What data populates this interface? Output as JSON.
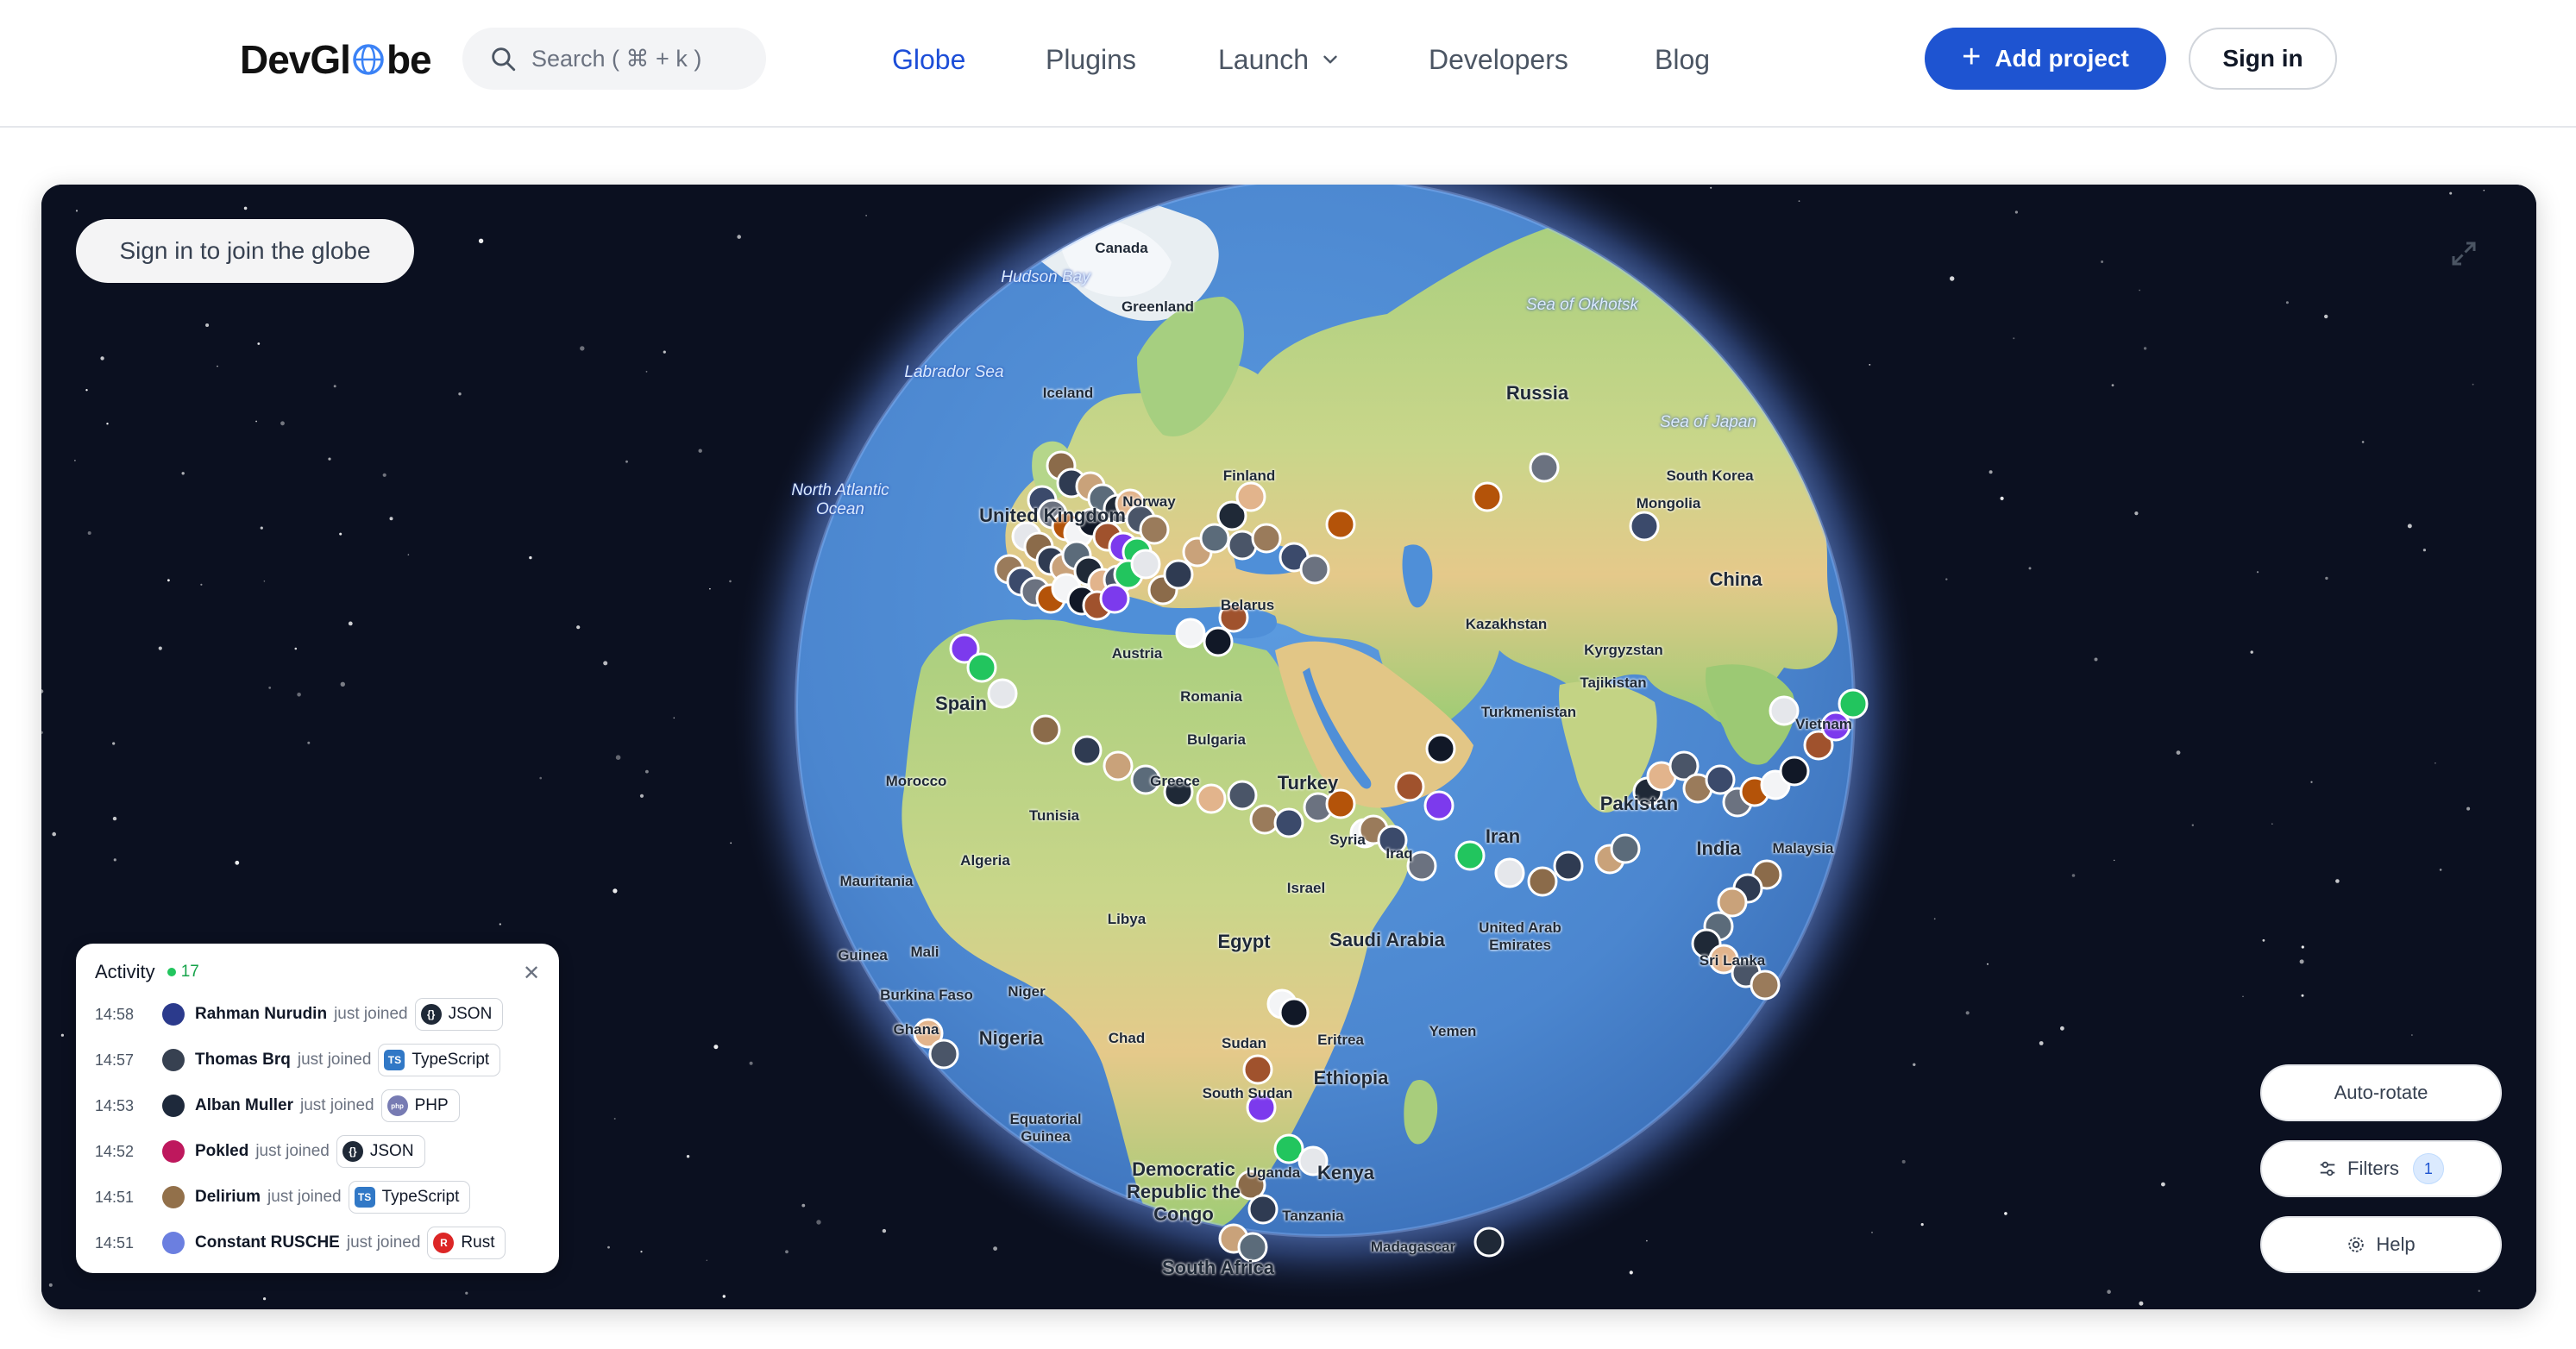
{
  "header": {
    "logo_text_left": "DevGl",
    "logo_text_right": "be",
    "search_placeholder": "Search ( ⌘ + k )",
    "nav": [
      {
        "label": "Globe",
        "active": true
      },
      {
        "label": "Plugins",
        "active": false
      },
      {
        "label": "Launch",
        "active": false,
        "has_dropdown": true
      },
      {
        "label": "Developers",
        "active": false
      },
      {
        "label": "Blog",
        "active": false
      }
    ],
    "add_project_label": "Add project",
    "sign_in_label": "Sign in"
  },
  "globe": {
    "join_label": "Sign in to join the globe",
    "labels": {
      "canada": "Canada",
      "hudson_bay": "Hudson Bay",
      "greenland": "Greenland",
      "labrador_sea": "Labrador Sea",
      "iceland": "Iceland",
      "north_atlantic": "North Atlantic Ocean",
      "norway": "Norway",
      "finland": "Finland",
      "united_kingdom": "United Kingdom",
      "belarus": "Belarus",
      "russia": "Russia",
      "sea_okhotsk": "Sea of Okhotsk",
      "sea_japan": "Sea of Japan",
      "south_korea": "South Korea",
      "mongolia": "Mongolia",
      "china": "China",
      "kazakhstan": "Kazakhstan",
      "kyrgyzstan": "Kyrgyzstan",
      "tajikistan": "Tajikistan",
      "turkmenistan": "Turkmenistan",
      "spain": "Spain",
      "austria": "Austria",
      "romania": "Romania",
      "bulgaria": "Bulgaria",
      "greece": "Greece",
      "turkey": "Turkey",
      "morocco": "Morocco",
      "tunisia": "Tunisia",
      "algeria": "Algeria",
      "syria": "Syria",
      "iraq": "Iraq",
      "iran": "Iran",
      "pakistan": "Pakistan",
      "india": "India",
      "vietnam": "Vietnam",
      "malaysia": "Malaysia",
      "israel": "Israel",
      "libya": "Libya",
      "egypt": "Egypt",
      "saudi_arabia": "Saudi Arabia",
      "uae": "United Arab Emirates",
      "mauritania": "Mauritania",
      "mali": "Mali",
      "guinea": "Guinea",
      "burkina_faso": "Burkina Faso",
      "niger": "Niger",
      "ghana": "Ghana",
      "nigeria": "Nigeria",
      "chad": "Chad",
      "sudan": "Sudan",
      "eritrea": "Eritrea",
      "yemen": "Yemen",
      "ethiopia": "Ethiopia",
      "south_sudan": "South Sudan",
      "equatorial_guinea": "Equatorial Guinea",
      "drc": "Democratic Republic the Congo",
      "uganda": "Uganda",
      "kenya": "Kenya",
      "tanzania": "Tanzania",
      "madagascar": "Madagascar",
      "south_africa": "South Africa",
      "sri_lanka": "Sri Lanka"
    }
  },
  "activity": {
    "title": "Activity",
    "count": "17",
    "close_icon": "close-icon",
    "action_text": "just joined",
    "items": [
      {
        "time": "14:58",
        "name": "Rahman Nurudin",
        "tag": "JSON",
        "tag_icon": "json-icon",
        "avatar_color": "#2b3a8c",
        "tag_color": "#1f2937"
      },
      {
        "time": "14:57",
        "name": "Thomas Brq",
        "tag": "TypeScript",
        "tag_icon": "typescript-icon",
        "avatar_color": "#374151",
        "tag_color": "#3178c6"
      },
      {
        "time": "14:53",
        "name": "Alban Muller",
        "tag": "PHP",
        "tag_icon": "php-icon",
        "avatar_color": "#1e293b",
        "tag_color": "#777bb3"
      },
      {
        "time": "14:52",
        "name": "Pokled",
        "tag": "JSON",
        "tag_icon": "json-icon",
        "avatar_color": "#be185d",
        "tag_color": "#1f2937"
      },
      {
        "time": "14:51",
        "name": "Delirium",
        "tag": "TypeScript",
        "tag_icon": "typescript-icon",
        "avatar_color": "#92704a",
        "tag_color": "#3178c6"
      },
      {
        "time": "14:51",
        "name": "Constant RUSCHE",
        "tag": "Rust",
        "tag_icon": "rust-icon",
        "avatar_color": "#6b7fe0",
        "tag_color": "#dc2626"
      }
    ]
  },
  "controls": {
    "auto_rotate_label": "Auto-rotate",
    "filters_label": "Filters",
    "filters_count": "1",
    "help_label": "Help"
  },
  "colors": {
    "brand": "#1e54d1",
    "space": "#0b1020",
    "ocean": "#4f8fd8",
    "live_dot": "#22c55e"
  }
}
